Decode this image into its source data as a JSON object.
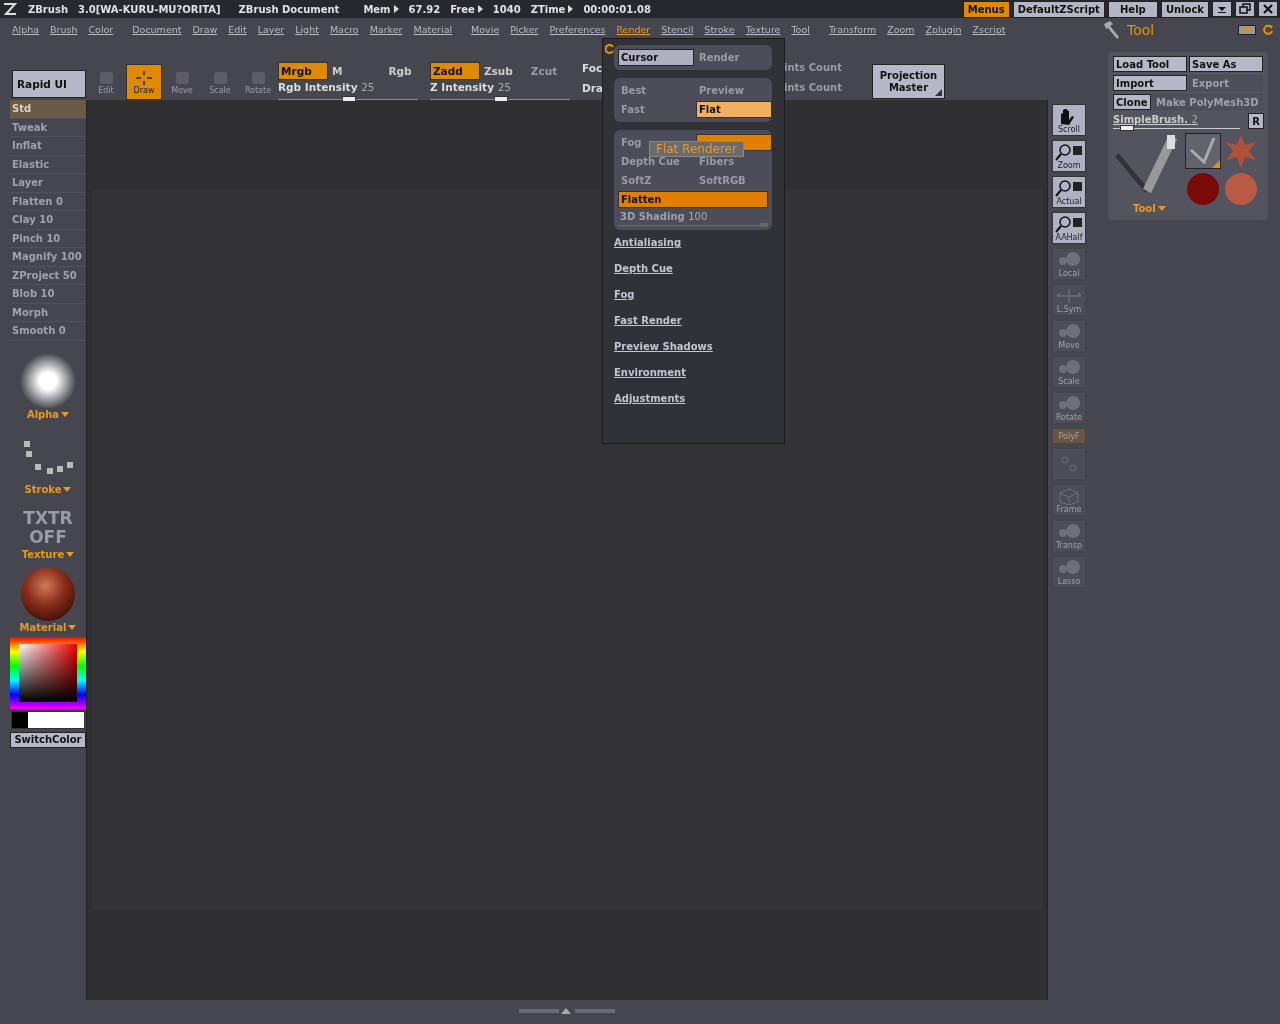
{
  "title_bar": {
    "app": "ZBrush",
    "version": "3.0[WA-KURU-MU?ORITA]",
    "document": "ZBrush Document",
    "stats": [
      {
        "label": "Mem",
        "value": "67.92"
      },
      {
        "label": "Free",
        "value": "1040"
      },
      {
        "label": "ZTime",
        "value": "00:00:01.08"
      }
    ],
    "buttons": [
      {
        "label": "Menus",
        "selected": true
      },
      {
        "label": "DefaultZScript",
        "selected": false
      },
      {
        "label": "Help",
        "selected": false
      },
      {
        "label": "Unlock",
        "selected": false
      }
    ]
  },
  "menu_bar": [
    {
      "label": "Alpha",
      "selected": false
    },
    {
      "label": "Brush",
      "selected": false
    },
    {
      "label": "Color",
      "selected": false
    },
    {
      "label": "Document",
      "selected": false
    },
    {
      "label": "Draw",
      "selected": false
    },
    {
      "label": "Edit",
      "selected": false
    },
    {
      "label": "Layer",
      "selected": false
    },
    {
      "label": "Light",
      "selected": false
    },
    {
      "label": "Macro",
      "selected": false
    },
    {
      "label": "Marker",
      "selected": false
    },
    {
      "label": "Material",
      "selected": false
    },
    {
      "label": "Movie",
      "selected": false
    },
    {
      "label": "Picker",
      "selected": false
    },
    {
      "label": "Preferences",
      "selected": false
    },
    {
      "label": "Render",
      "selected": true
    },
    {
      "label": "Stencil",
      "selected": false
    },
    {
      "label": "Stroke",
      "selected": false
    },
    {
      "label": "Texture",
      "selected": false
    },
    {
      "label": "Tool",
      "selected": false
    },
    {
      "label": "Transform",
      "selected": false
    },
    {
      "label": "Zoom",
      "selected": false
    },
    {
      "label": "Zplugin",
      "selected": false
    },
    {
      "label": "Zscript",
      "selected": false
    }
  ],
  "toolbar": {
    "rapid_ui": "Rapid UI",
    "modes": [
      {
        "label": "Edit",
        "selected": false,
        "disabled": true
      },
      {
        "label": "Draw",
        "selected": true,
        "disabled": false
      },
      {
        "label": "Move",
        "selected": false,
        "disabled": true
      },
      {
        "label": "Scale",
        "selected": false,
        "disabled": true
      },
      {
        "label": "Rotate",
        "selected": false,
        "disabled": true
      }
    ],
    "rgb": [
      {
        "label": "Mrgb",
        "on": true
      },
      {
        "label": "M",
        "on": false
      },
      {
        "label": "Rgb",
        "on": false
      }
    ],
    "z": [
      {
        "label": "Zadd",
        "on": true,
        "disabled": false
      },
      {
        "label": "Zsub",
        "on": false,
        "disabled": false
      },
      {
        "label": "Zcut",
        "on": false,
        "disabled": true
      }
    ],
    "sliders": [
      {
        "label": "Rgb Intensity",
        "value": "25",
        "level": 0.5
      },
      {
        "label": "Z Intensity",
        "value": "25",
        "level": 0.5
      }
    ],
    "cut_labels": [
      "Foc",
      "Dra"
    ],
    "faded_labels": [
      "ints Count",
      "ints Count"
    ],
    "projection_master": "Projection Master"
  },
  "left_palette": {
    "brushes": [
      {
        "label": "Std",
        "selected": true
      },
      {
        "label": "Tweak",
        "selected": false
      },
      {
        "label": "Inflat",
        "selected": false
      },
      {
        "label": "Elastic",
        "selected": false
      },
      {
        "label": "Layer",
        "selected": false
      },
      {
        "label": "Flatten",
        "value": "0",
        "selected": false
      },
      {
        "label": "Clay",
        "value": "10",
        "selected": false
      },
      {
        "label": "Pinch",
        "value": "10",
        "selected": false
      },
      {
        "label": "Magnify",
        "value": "100",
        "selected": false
      },
      {
        "label": "ZProject",
        "value": "50",
        "selected": false
      },
      {
        "label": "Blob",
        "value": "10",
        "selected": false
      },
      {
        "label": "Morph",
        "selected": false
      },
      {
        "label": "Smooth",
        "value": "0",
        "selected": false
      }
    ],
    "alpha": "Alpha",
    "stroke": "Stroke",
    "texture_off": [
      "TXTR",
      "OFF"
    ],
    "texture": "Texture",
    "material": "Material",
    "switch_color": "SwitchColor"
  },
  "right_shelf": [
    {
      "label": "Scroll",
      "kind": "hand",
      "disabled": false
    },
    {
      "label": "Zoom",
      "kind": "magnifier",
      "disabled": false
    },
    {
      "label": "Actual",
      "kind": "magnifier",
      "disabled": false
    },
    {
      "label": "AAHalf",
      "kind": "magnifier",
      "disabled": false
    },
    {
      "label": "Local",
      "kind": "sphere",
      "disabled": true
    },
    {
      "label": "L.Sym",
      "kind": "axes",
      "disabled": true
    },
    {
      "label": "Move",
      "kind": "sphere",
      "disabled": true
    },
    {
      "label": "Scale",
      "kind": "sphere",
      "disabled": true
    },
    {
      "label": "Rotate",
      "kind": "sphere",
      "disabled": true
    },
    {
      "label": "PolyF",
      "kind": "strip",
      "disabled": true
    },
    {
      "kind": "gizmo",
      "disabled": true
    },
    {
      "label": "Frame",
      "kind": "cube",
      "disabled": true
    },
    {
      "label": "Transp",
      "kind": "sphere",
      "disabled": true
    },
    {
      "label": "Lasso",
      "kind": "sphere",
      "disabled": true
    }
  ],
  "tool_panel": {
    "title": "Tool",
    "buttons": [
      {
        "label": "Load Tool",
        "disabled": false
      },
      {
        "label": "Save As",
        "disabled": false
      },
      {
        "label": "Import",
        "disabled": false
      },
      {
        "label": "Export",
        "disabled": true
      },
      {
        "label": "Clone",
        "disabled": false
      },
      {
        "label": "Make PolyMesh3D",
        "disabled": true
      }
    ],
    "slider": {
      "label": "SimpleBrush.",
      "value": "2",
      "level": 0.1
    },
    "r_button": "R",
    "thumbnails": [
      {
        "kind": "brush",
        "selected": true
      },
      {
        "kind": "star",
        "selected": false
      },
      {
        "kind": "dark-sphere",
        "selected": false
      },
      {
        "kind": "sphere",
        "selected": false
      }
    ],
    "dropdown": "Tool"
  },
  "render_menu": {
    "toggles": [
      {
        "label": "Cursor",
        "selected": true
      },
      {
        "label": "Render",
        "selected": false
      }
    ],
    "modes": [
      {
        "label": "Best",
        "selected": false
      },
      {
        "label": "Preview",
        "selected": false
      },
      {
        "label": "Fast",
        "selected": false
      },
      {
        "label": "Flat",
        "selected": true
      }
    ],
    "effects": [
      {
        "label": "Fog",
        "on": false
      },
      {
        "on": true
      },
      {
        "label": "Depth Cue",
        "on": false
      },
      {
        "label": "Fibers",
        "on": false
      },
      {
        "label": "SoftZ",
        "on": false
      },
      {
        "label": "SoftRGB",
        "on": false
      }
    ],
    "flatten": {
      "label": "Flatten",
      "on": true
    },
    "shading": {
      "label": "3D Shading",
      "value": "100",
      "level": 1
    },
    "tooltip": "Flat Renderer",
    "submenus": [
      "Antialiasing",
      "Depth Cue",
      "Fog",
      "Fast Render",
      "Preview Shadows",
      "Environment",
      "Adjustments"
    ]
  }
}
